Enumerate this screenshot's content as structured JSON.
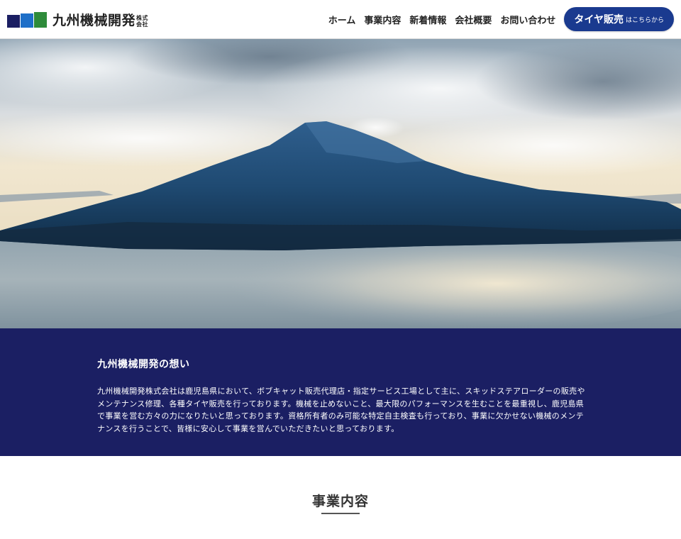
{
  "header": {
    "company_name": "九州機械開発",
    "company_suffix": "株式会社",
    "logo_colors": [
      "#1b1f63",
      "#1565c0",
      "#2e7d32"
    ],
    "nav": [
      {
        "label": "ホーム"
      },
      {
        "label": "事業内容"
      },
      {
        "label": "新着情報"
      },
      {
        "label": "会社概要"
      },
      {
        "label": "お問い合わせ"
      }
    ],
    "cta": {
      "main": "タイヤ販売",
      "sub": "はこちらから",
      "color": "#1a3a8f"
    }
  },
  "hero": {
    "subject": "sakurajima-volcano-photo"
  },
  "mission": {
    "title": "九州機械開発の想い",
    "body": "九州機械開発株式会社は鹿児島県において、ボブキャット販売代理店・指定サービス工場として主に、スキッドステアローダーの販売やメンテナンス修理、各種タイヤ販売を行っております。機械を止めないこと、最大限のパフォーマンスを生むことを最重視し、鹿児島県で事業を営む方々の力になりたいと思っております。資格所有者のみ可能な特定自主検査も行っており、事業に欠かせない機械のメンテナンスを行うことで、皆様に安心して事業を営んでいただきたいと思っております。",
    "background": "#1b1f63"
  },
  "services": {
    "title": "事業内容"
  }
}
